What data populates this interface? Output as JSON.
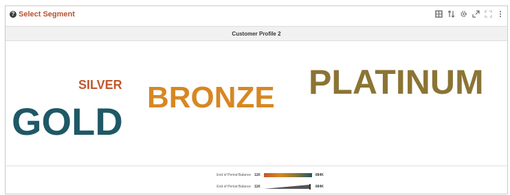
{
  "header": {
    "title": "Select Segment",
    "icons": [
      "grid-icon",
      "sort-icon",
      "gear-icon",
      "expand-icon",
      "fullscreen-icon",
      "more-icon"
    ]
  },
  "subheader": {
    "title": "Customer Profile 2"
  },
  "cloud": {
    "words": [
      {
        "text": "SILVER",
        "color": "#c0582d"
      },
      {
        "text": "BRONZE",
        "color": "#d78723"
      },
      {
        "text": "PLATINUM",
        "color": "#8b7434"
      },
      {
        "text": "GOLD",
        "color": "#1f5866"
      }
    ]
  },
  "legend": {
    "color": {
      "label": "End of Period Balance",
      "min": "11K",
      "max": "684K"
    },
    "size": {
      "label": "End of Period Balance",
      "min": "11K",
      "max": "684K"
    }
  }
}
